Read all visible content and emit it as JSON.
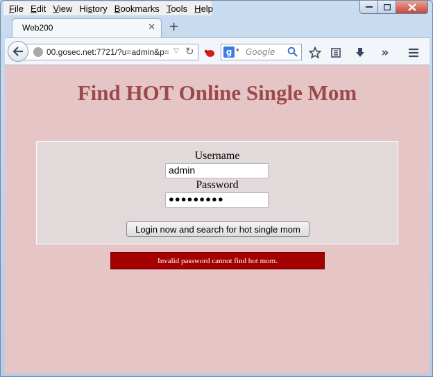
{
  "menu": [
    "File",
    "Edit",
    "View",
    "History",
    "Bookmarks",
    "Tools",
    "Help"
  ],
  "menu_mnemonic": [
    "F",
    "E",
    "V",
    "s",
    "B",
    "T",
    "H"
  ],
  "tab": {
    "title": "Web200"
  },
  "address": {
    "url": "00.gosec.net:7721/?u=admin&p="
  },
  "search": {
    "placeholder": "Google",
    "engine_letter": "g"
  },
  "icons": [
    "back-icon",
    "globe-icon",
    "reload-icon",
    "bug-icon",
    "google-icon",
    "search-icon",
    "star-icon",
    "reading-list-icon",
    "download-icon",
    "overflow-icon",
    "menu-icon"
  ],
  "page": {
    "heading": "Find HOT Online Single Mom",
    "username_label": "Username",
    "username_value": "admin",
    "password_label": "Password",
    "password_mask": "●●●●●●●●●",
    "login_button": "Login now and search for hot single mom",
    "error": "Invalid password cannot find hot mom."
  },
  "colors": {
    "page_bg": "#e6c5c7",
    "heading": "#9b4a4c",
    "panel_bg": "#e2d9da",
    "error_bg": "#a50000"
  }
}
